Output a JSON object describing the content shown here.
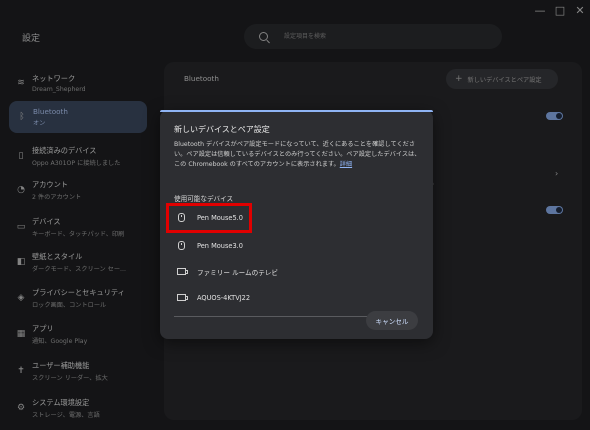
{
  "window_controls": {
    "minimize": "—",
    "maximize": "□",
    "close": "✕"
  },
  "app_title": "設定",
  "search": {
    "placeholder": "設定項目を検索"
  },
  "sidebar": {
    "items": [
      {
        "title": "ネットワーク",
        "subtitle": "Dream_Shepherd",
        "icon": "wifi-icon",
        "glyph": "≋"
      },
      {
        "title": "Bluetooth",
        "subtitle": "オン",
        "icon": "bluetooth-icon",
        "glyph": "ᛒ"
      },
      {
        "title": "接続済みのデバイス",
        "subtitle": "Oppo A301OP に接続しました",
        "icon": "phone-icon",
        "glyph": "▯"
      },
      {
        "title": "アカウント",
        "subtitle": "2 件のアカウント",
        "icon": "account-icon",
        "glyph": "◔"
      },
      {
        "title": "デバイス",
        "subtitle": "キーボード、タッチパッド、印刷",
        "icon": "laptop-icon",
        "glyph": "▭"
      },
      {
        "title": "壁紙とスタイル",
        "subtitle": "ダークモード、スクリーン セー...",
        "icon": "palette-icon",
        "glyph": "◧"
      },
      {
        "title": "プライバシーとセキュリティ",
        "subtitle": "ロック画面、コントロール",
        "icon": "shield-icon",
        "glyph": "◈"
      },
      {
        "title": "アプリ",
        "subtitle": "通知、Google Play",
        "icon": "apps-icon",
        "glyph": "▦"
      },
      {
        "title": "ユーザー補助機能",
        "subtitle": "スクリーン リーダー、拡大",
        "icon": "accessibility-icon",
        "glyph": "✝"
      },
      {
        "title": "システム環境設定",
        "subtitle": "ストレージ、電源、言語",
        "icon": "system-icon",
        "glyph": "⚙"
      }
    ]
  },
  "content": {
    "header": "Bluetooth",
    "pair_button": "新しいデバイスとペア設定",
    "bg_fragment": "ぃ"
  },
  "dialog": {
    "title": "新しいデバイスとペア設定",
    "description": "Bluetooth デバイスがペア設定モードになっていて、近くにあることを確認してください。ペア設定は信頼しているデバイスとのみ行ってください。ペア設定したデバイスは、この Chromebook のすべてのアカウントに表示されます。",
    "details_link": "詳細",
    "section": "使用可能なデバイス",
    "devices": [
      {
        "name": "Pen Mouse5.0",
        "icon": "mouse-icon"
      },
      {
        "name": "Pen Mouse3.0",
        "icon": "mouse-icon"
      },
      {
        "name": "ファミリー ルームのテレビ",
        "icon": "tv-icon"
      },
      {
        "name": "AQUOS-4KTVJ22",
        "icon": "tv-icon"
      }
    ],
    "cancel": "キャンセル"
  }
}
